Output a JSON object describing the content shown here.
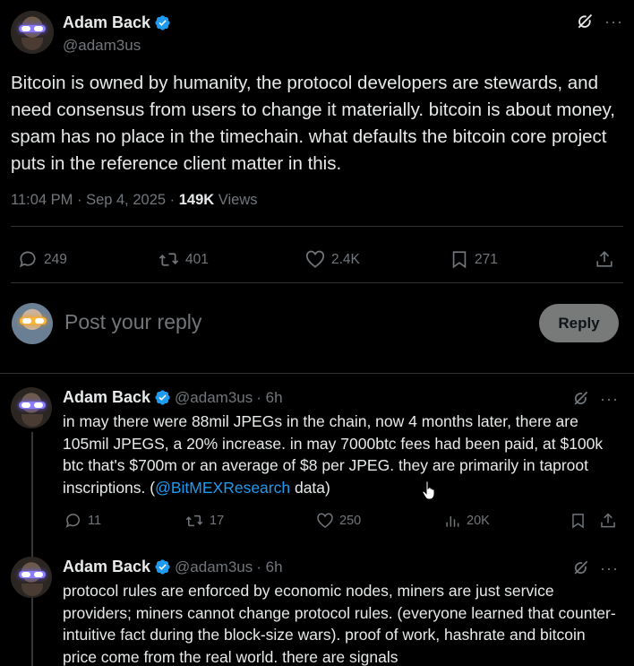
{
  "main_tweet": {
    "author": {
      "name": "Adam Back",
      "handle": "@adam3us"
    },
    "text": "Bitcoin is owned by humanity, the protocol developers are stewards, and need consensus from users to change it materially. bitcoin is about money, spam has no place in the timechain. what defaults the bitcoin core project puts in the reference client matter in this.",
    "time": "11:04 PM · Sep 4, 2025 · ",
    "views_count": "149K",
    "views_label": " Views",
    "stats": {
      "replies": "249",
      "reposts": "401",
      "likes": "2.4K",
      "bookmarks": "271"
    }
  },
  "composer": {
    "placeholder": "Post your reply",
    "button": "Reply"
  },
  "replies": [
    {
      "author": {
        "name": "Adam Back",
        "handle": "@adam3us",
        "time": "· 6h"
      },
      "text_before": "in may there were 88mil JPEGs in the chain, now 4 months later, there are 105mil JPEGS, a 20% increase. in may 7000btc fees had been paid, at $100k btc that's $700m or an average of $8 per JPEG. they are primarily in taproot inscriptions. (",
      "mention": "@BitMEXResearch",
      "text_after": " data)",
      "stats": {
        "replies": "11",
        "reposts": "17",
        "likes": "250",
        "views": "20K"
      }
    },
    {
      "author": {
        "name": "Adam Back",
        "handle": "@adam3us",
        "time": "· 6h"
      },
      "text": "protocol rules are enforced by economic nodes, miners are just service providers; miners cannot change protocol rules. (everyone learned that counter-intuitive fact during the block-size wars). proof of work, hashrate and bitcoin price come from the real world. there are signals"
    }
  ],
  "icons": {
    "verified": "verified-badge-icon",
    "grok": "grok-icon",
    "more": "more-dots-icon",
    "reply": "reply-icon",
    "repost": "repost-icon",
    "like": "like-icon",
    "views": "views-icon",
    "bookmark": "bookmark-icon",
    "share": "share-icon"
  },
  "colors": {
    "background": "#000000",
    "text": "#e7e9ea",
    "muted": "#71767b",
    "link": "#1d9bf0",
    "verified": "#1d9bf0"
  }
}
